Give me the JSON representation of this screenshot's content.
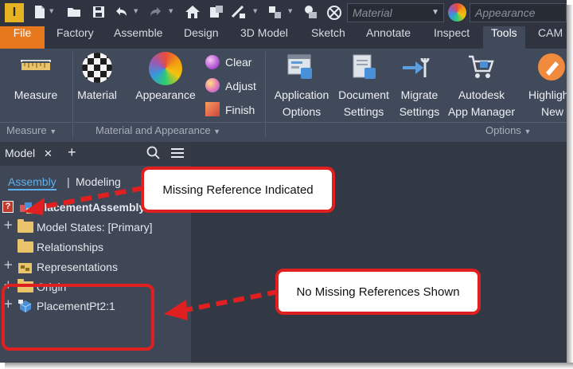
{
  "quick_access": {
    "logo_letter": "I",
    "icons": [
      "new-icon",
      "open-icon",
      "save-icon",
      "undo-icon",
      "redo-icon",
      "home-icon",
      "properties-icon",
      "measure-tool-icon",
      "select-icon",
      "material-sphere-icon",
      "appearance-sphere-icon"
    ],
    "material_value": "Material",
    "appearance_value": "Appearance"
  },
  "ribbon_tabs": [
    "File",
    "Factory",
    "Assemble",
    "Design",
    "3D Model",
    "Sketch",
    "Annotate",
    "Inspect",
    "Tools",
    "CAM"
  ],
  "active_tab": "Tools",
  "ribbon": {
    "measure": {
      "button": "Measure",
      "panel": "Measure"
    },
    "material_appearance": {
      "material": "Material",
      "appearance": "Appearance",
      "clear": "Clear",
      "adjust": "Adjust",
      "finish": "Finish",
      "panel": "Material and Appearance"
    },
    "options": {
      "application_options_1": "Application",
      "application_options_2": "Options",
      "document_settings_1": "Document",
      "document_settings_2": "Settings",
      "migrate_settings_1": "Migrate",
      "migrate_settings_2": "Settings",
      "app_manager_1": "Autodesk",
      "app_manager_2": "App Manager",
      "highlight_1": "Highlight",
      "highlight_2": "New",
      "panel": "Options"
    }
  },
  "browser": {
    "tab_label": "Model",
    "close_glyph": "✕",
    "add_glyph": "+",
    "view_assembly": "Assembly",
    "view_sep": "|",
    "view_modeling": "Modeling",
    "tree": {
      "root": "PlacementAssembly",
      "model_states": "Model States: [Primary]",
      "relationships": "Relationships",
      "representations": "Representations",
      "origin": "Origin",
      "part": "PlacementPt2:1"
    }
  },
  "callouts": {
    "missing": "Missing Reference Indicated",
    "none": "No Missing References Shown"
  },
  "colors": {
    "accent_file_tab": "#e8781d",
    "callout_border": "#e02020",
    "folder": "#e9c46a",
    "logo": "#e6b422"
  }
}
